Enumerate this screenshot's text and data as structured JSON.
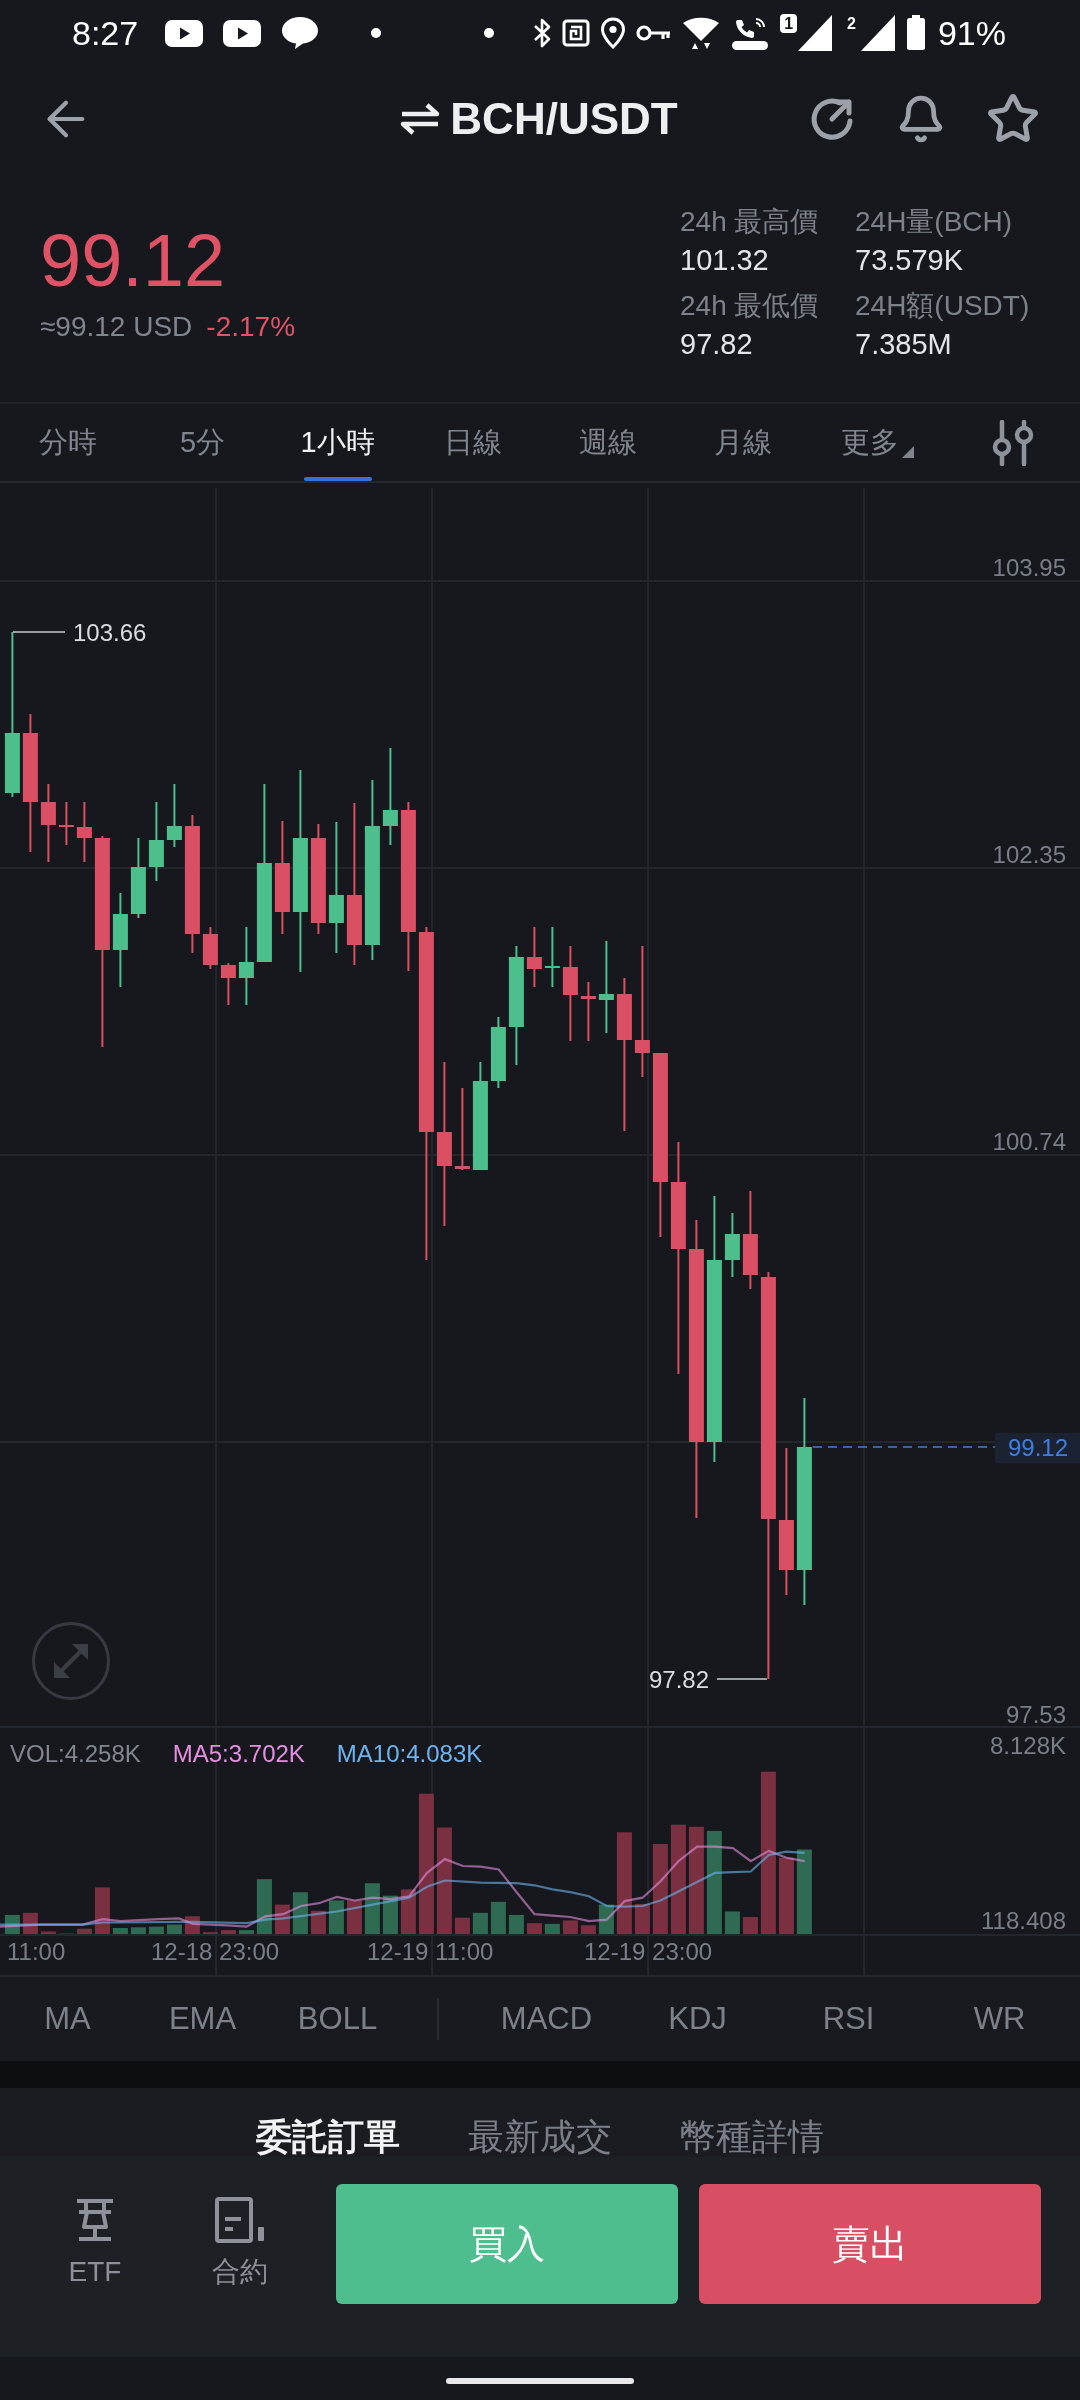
{
  "status_bar": {
    "time": "8:27",
    "sims": [
      {
        "label": "1",
        "active": true
      },
      {
        "label": "2",
        "active": false
      }
    ],
    "battery": "91%"
  },
  "header": {
    "pair": "BCH/USDT"
  },
  "ticker": {
    "price": "99.12",
    "falling": true,
    "fiat": "≈99.12 USD",
    "change": "-2.17%",
    "stats": [
      {
        "label": "24h 最高價",
        "value": "101.32"
      },
      {
        "label": "24H量(BCH)",
        "value": "73.579K"
      },
      {
        "label": "24h 最低價",
        "value": "97.82"
      },
      {
        "label": "24H額(USDT)",
        "value": "7.385M"
      }
    ]
  },
  "intervals": [
    {
      "label": "分時",
      "selected": false,
      "kind": "option"
    },
    {
      "label": "5分",
      "selected": false,
      "kind": "option"
    },
    {
      "label": "1小時",
      "selected": true,
      "kind": "option"
    },
    {
      "label": "日線",
      "selected": false,
      "kind": "option"
    },
    {
      "label": "週線",
      "selected": false,
      "kind": "option"
    },
    {
      "label": "月線",
      "selected": false,
      "kind": "option"
    },
    {
      "label": "更多",
      "selected": false,
      "kind": "menu"
    }
  ],
  "chart": {
    "price_axis": [
      "103.95",
      "102.35",
      "100.74",
      "97.53"
    ],
    "high_label": "103.66",
    "low_label": "97.82",
    "last_price": "99.12"
  },
  "volume": {
    "legend": [
      {
        "text": "VOL:4.258K",
        "color": "#83878f"
      },
      {
        "text": "MA5:3.702K",
        "color": "#e68fe2"
      },
      {
        "text": "MA10:4.083K",
        "color": "#6db5f0"
      }
    ],
    "axis_max": "8.128K",
    "axis_min": "118.408"
  },
  "time_axis": [
    "11:00",
    "12-18 23:00",
    "12-19 11:00",
    "12-19 23:00"
  ],
  "indicators": {
    "main": [
      "MA",
      "EMA",
      "BOLL"
    ],
    "sub": [
      "MACD",
      "KDJ",
      "RSI",
      "WR"
    ]
  },
  "detail_tabs": [
    {
      "label": "委託訂單",
      "selected": true
    },
    {
      "label": "最新成交",
      "selected": false
    },
    {
      "label": "幣種詳情",
      "selected": false
    }
  ],
  "bottom_bar": {
    "shortcuts": [
      {
        "label": "ETF",
        "kind": "etf"
      },
      {
        "label": "合約",
        "kind": "contract"
      }
    ],
    "actions": [
      {
        "label": "買入",
        "kind": "buy"
      },
      {
        "label": "賣出",
        "kind": "sell"
      }
    ]
  }
}
